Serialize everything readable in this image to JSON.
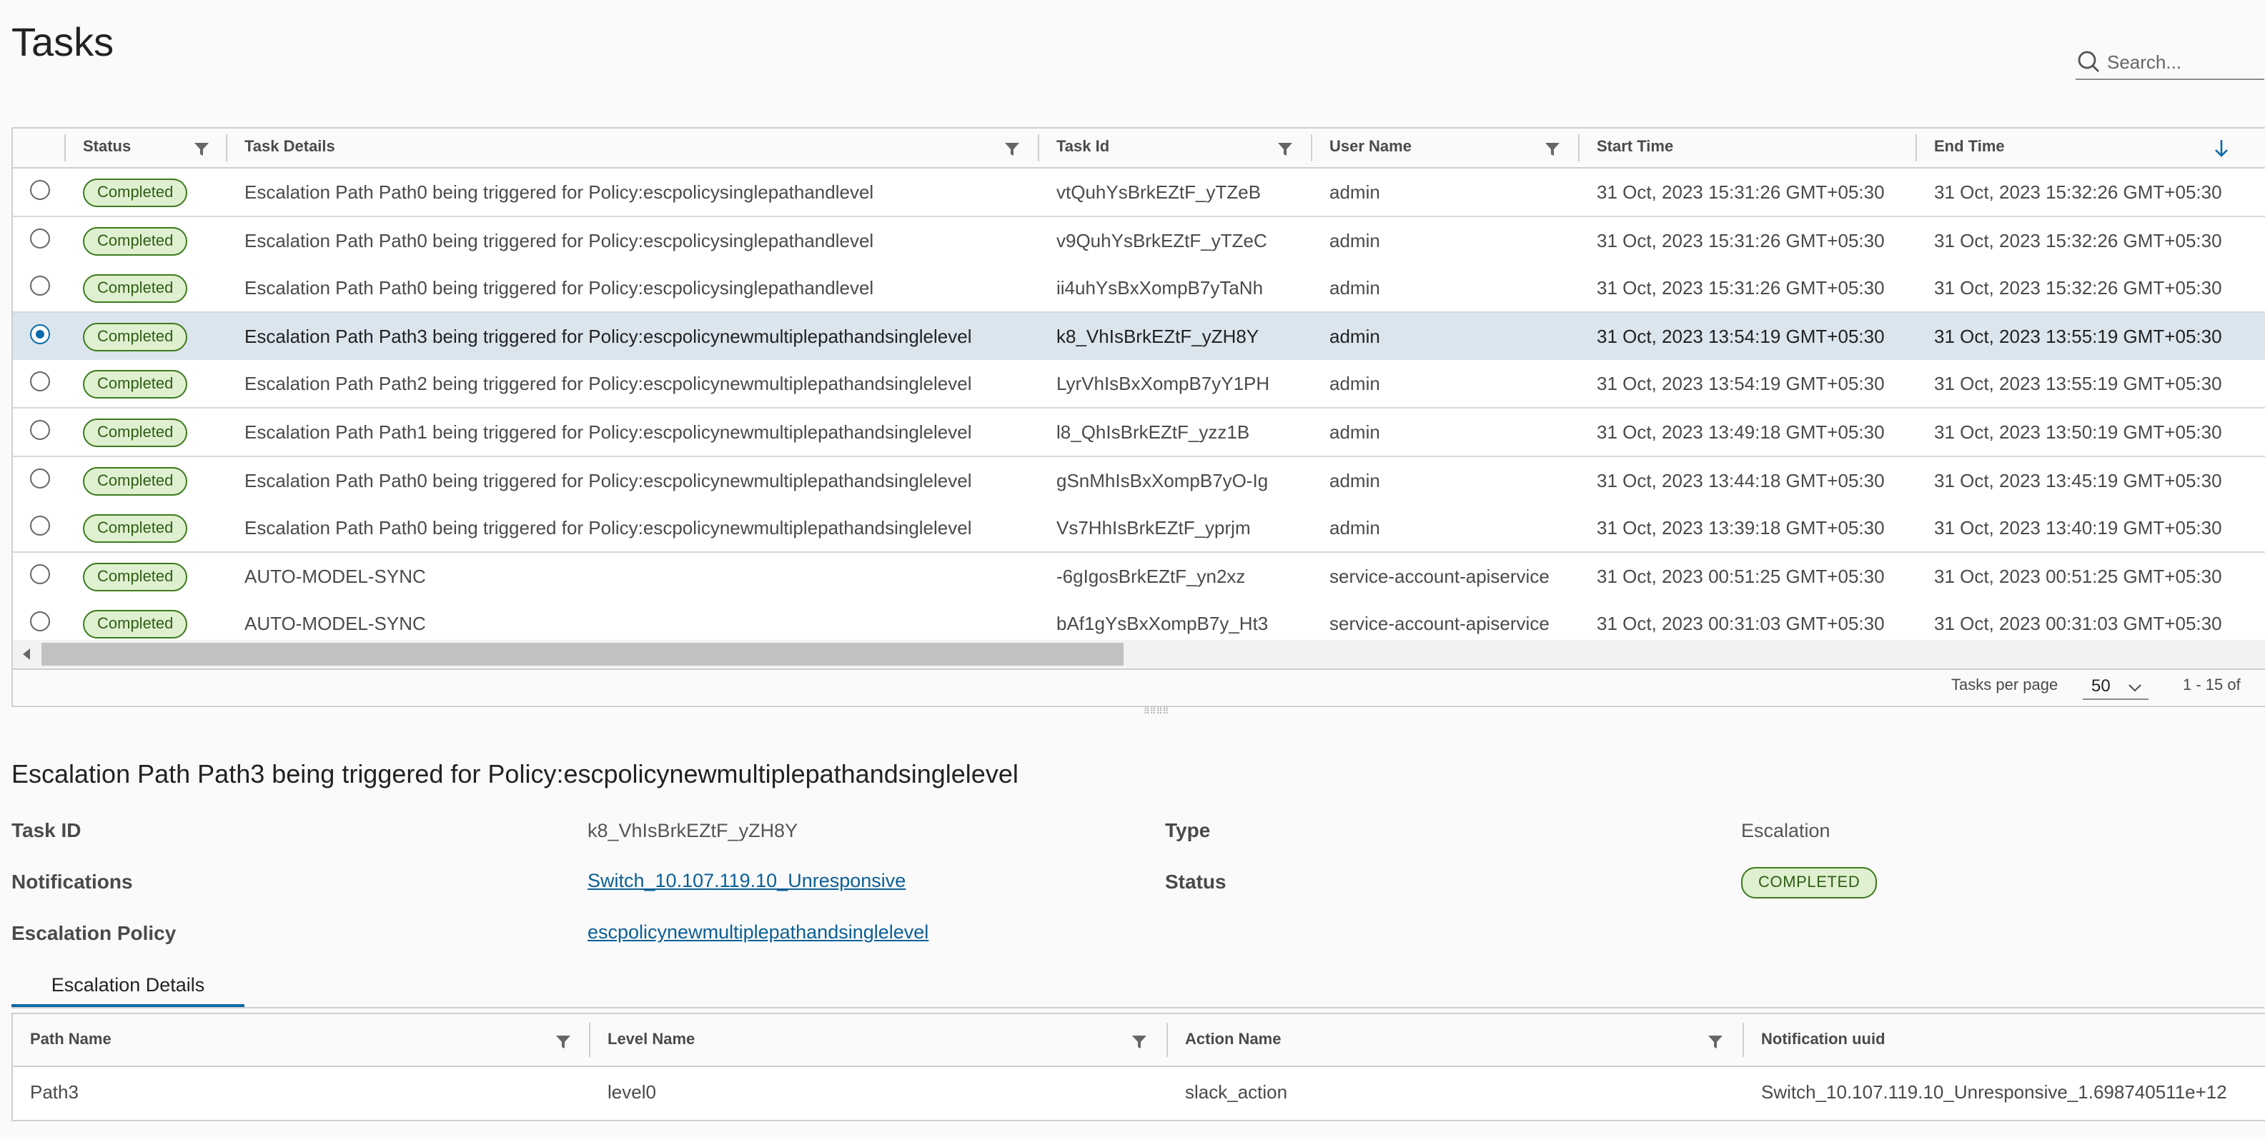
{
  "page": {
    "title": "Tasks"
  },
  "search": {
    "placeholder": "Search..."
  },
  "grid": {
    "columns": [
      "Status",
      "Task Details",
      "Task Id",
      "User Name",
      "Start Time",
      "End Time"
    ],
    "rows": [
      {
        "status": "Completed",
        "details": "Escalation Path Path0 being triggered for Policy:escpolicysinglepathandlevel",
        "task_id": "vtQuhYsBrkEZtF_yTZeB",
        "user": "admin",
        "start": "31 Oct, 2023 15:31:26 GMT+05:30",
        "end": "31 Oct, 2023 15:32:26 GMT+05:30",
        "selected": false
      },
      {
        "status": "Completed",
        "details": "Escalation Path Path0 being triggered for Policy:escpolicysinglepathandlevel",
        "task_id": "v9QuhYsBrkEZtF_yTZeC",
        "user": "admin",
        "start": "31 Oct, 2023 15:31:26 GMT+05:30",
        "end": "31 Oct, 2023 15:32:26 GMT+05:30",
        "selected": false
      },
      {
        "status": "Completed",
        "details": "Escalation Path Path0 being triggered for Policy:escpolicysinglepathandlevel",
        "task_id": "ii4uhYsBxXompB7yTaNh",
        "user": "admin",
        "start": "31 Oct, 2023 15:31:26 GMT+05:30",
        "end": "31 Oct, 2023 15:32:26 GMT+05:30",
        "selected": false
      },
      {
        "status": "Completed",
        "details": "Escalation Path Path3 being triggered for Policy:escpolicynewmultiplepathandsinglelevel",
        "task_id": "k8_VhIsBrkEZtF_yZH8Y",
        "user": "admin",
        "start": "31 Oct, 2023 13:54:19 GMT+05:30",
        "end": "31 Oct, 2023 13:55:19 GMT+05:30",
        "selected": true
      },
      {
        "status": "Completed",
        "details": "Escalation Path Path2 being triggered for Policy:escpolicynewmultiplepathandsinglelevel",
        "task_id": "LyrVhIsBxXompB7yY1PH",
        "user": "admin",
        "start": "31 Oct, 2023 13:54:19 GMT+05:30",
        "end": "31 Oct, 2023 13:55:19 GMT+05:30",
        "selected": false
      },
      {
        "status": "Completed",
        "details": "Escalation Path Path1 being triggered for Policy:escpolicynewmultiplepathandsinglelevel",
        "task_id": "l8_QhIsBrkEZtF_yzz1B",
        "user": "admin",
        "start": "31 Oct, 2023 13:49:18 GMT+05:30",
        "end": "31 Oct, 2023 13:50:19 GMT+05:30",
        "selected": false
      },
      {
        "status": "Completed",
        "details": "Escalation Path Path0 being triggered for Policy:escpolicynewmultiplepathandsinglelevel",
        "task_id": "gSnMhIsBxXompB7yO-Ig",
        "user": "admin",
        "start": "31 Oct, 2023 13:44:18 GMT+05:30",
        "end": "31 Oct, 2023 13:45:19 GMT+05:30",
        "selected": false
      },
      {
        "status": "Completed",
        "details": "Escalation Path Path0 being triggered for Policy:escpolicynewmultiplepathandsinglelevel",
        "task_id": "Vs7HhIsBrkEZtF_yprjm",
        "user": "admin",
        "start": "31 Oct, 2023 13:39:18 GMT+05:30",
        "end": "31 Oct, 2023 13:40:19 GMT+05:30",
        "selected": false
      },
      {
        "status": "Completed",
        "details": "AUTO-MODEL-SYNC",
        "task_id": "-6gIgosBrkEZtF_yn2xz",
        "user": "service-account-apiservice",
        "start": "31 Oct, 2023 00:51:25 GMT+05:30",
        "end": "31 Oct, 2023 00:51:25 GMT+05:30",
        "selected": false
      },
      {
        "status": "Completed",
        "details": "AUTO-MODEL-SYNC",
        "task_id": "bAf1gYsBxXompB7y_Ht3",
        "user": "service-account-apiservice",
        "start": "31 Oct, 2023 00:31:03 GMT+05:30",
        "end": "31 Oct, 2023 00:31:03 GMT+05:30",
        "selected": false
      }
    ],
    "footer": {
      "per_page_label": "Tasks per page",
      "per_page_value": "50",
      "range": "1 - 15 of"
    }
  },
  "detail": {
    "title": "Escalation Path Path3 being triggered for Policy:escpolicynewmultiplepathandsinglelevel",
    "task_id_label": "Task ID",
    "task_id_value": "k8_VhIsBrkEZtF_yZH8Y",
    "type_label": "Type",
    "type_value": "Escalation",
    "notifications_label": "Notifications",
    "notifications_value": "Switch_10.107.119.10_Unresponsive",
    "status_label": "Status",
    "status_value": "COMPLETED",
    "policy_label": "Escalation Policy",
    "policy_value": "escpolicynewmultiplepathandsinglelevel",
    "tab_label": "Escalation Details",
    "table": {
      "columns": [
        "Path Name",
        "Level Name",
        "Action Name",
        "Notification uuid"
      ],
      "rows": [
        {
          "path": "Path3",
          "level": "level0",
          "action": "slack_action",
          "uuid": "Switch_10.107.119.10_Unresponsive_1.698740511e+12"
        }
      ]
    }
  },
  "colors": {
    "accent": "#0b6aa8",
    "badge_bg": "#dff0d0",
    "badge_border": "#3d7a1c",
    "selected_row": "#dbe5ee"
  }
}
